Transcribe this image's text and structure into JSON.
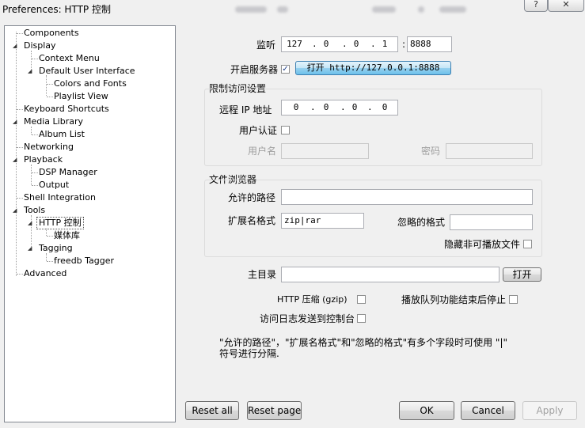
{
  "window": {
    "title": "Preferences: HTTP 控制",
    "help_label": "?",
    "close_label": "✕"
  },
  "tree": {
    "items": [
      {
        "label": "Components"
      },
      {
        "label": "Display",
        "expander": "◢"
      },
      {
        "label": "Context Menu"
      },
      {
        "label": "Default User Interface",
        "expander": "◢"
      },
      {
        "label": "Colors and Fonts"
      },
      {
        "label": "Playlist View"
      },
      {
        "label": "Keyboard Shortcuts"
      },
      {
        "label": "Media Library",
        "expander": "◢"
      },
      {
        "label": "Album List"
      },
      {
        "label": "Networking"
      },
      {
        "label": "Playback",
        "expander": "◢"
      },
      {
        "label": "DSP Manager"
      },
      {
        "label": "Output"
      },
      {
        "label": "Shell Integration"
      },
      {
        "label": "Tools",
        "expander": "◢"
      },
      {
        "label": "HTTP 控制",
        "expander": "◢",
        "selected": true
      },
      {
        "label": "媒体库"
      },
      {
        "label": "Tagging",
        "expander": "◢"
      },
      {
        "label": "freedb Tagger"
      },
      {
        "label": "Advanced"
      }
    ]
  },
  "server": {
    "listen_label": "监听",
    "ip": [
      "127",
      "0",
      "0",
      "1"
    ],
    "ip_separator": ".",
    "port_separator": ":",
    "port": "8888",
    "enable_label": "开启服务器",
    "enable_checked": "✓",
    "open_button": "打开 http://127.0.0.1:8888"
  },
  "access": {
    "group_title": "限制访问设置",
    "remote_ip_label": "远程 IP 地址",
    "remote_ip": [
      "0",
      "0",
      "0",
      "0"
    ],
    "auth_label": "用户认证",
    "username_label": "用户名",
    "password_label": "密码"
  },
  "browser": {
    "group_title": "文件浏览器",
    "allowed_paths_label": "允许的路径",
    "extensions_label": "扩展名格式",
    "extensions_value": "zip|rar",
    "ignored_label": "忽略的格式",
    "hide_unplayable_label": "隐藏非可播放文件"
  },
  "home_dir": {
    "label": "主目录",
    "open_button": "打开"
  },
  "options": {
    "gzip_label": "HTTP 压缩 (gzip)",
    "stop_after_queue_label": "播放队列功能结束后停止",
    "log_console_label": "访问日志发送到控制台"
  },
  "note": "\"允许的路径\"，\"扩展名格式\"和\"忽略的格式\"有多个字段时可使用 \"|\"\n符号进行分隔.",
  "footer": {
    "reset_all": "Reset all",
    "reset_page": "Reset page",
    "ok": "OK",
    "cancel": "Cancel",
    "apply": "Apply"
  }
}
